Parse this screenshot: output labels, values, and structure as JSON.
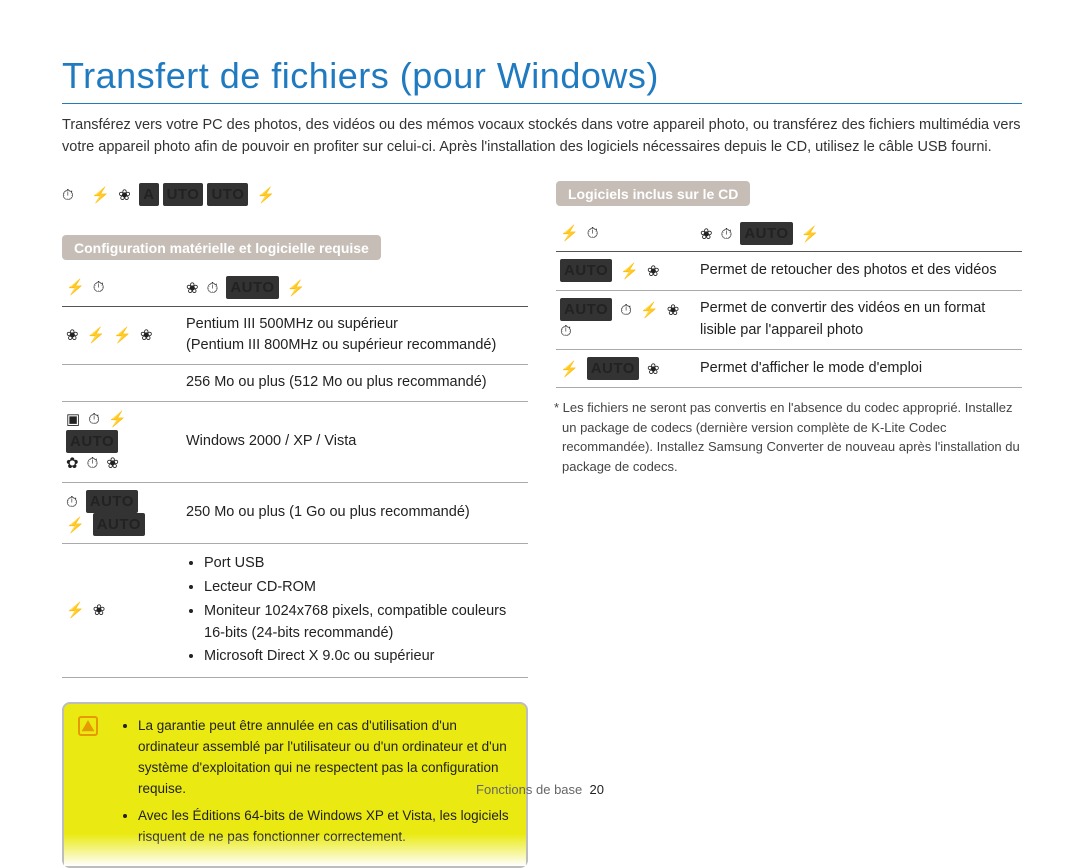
{
  "title": "Transfert de fichiers (pour Windows)",
  "intro": "Transférez vers votre PC des photos, des vidéos ou des mémos vocaux stockés dans votre appareil photo, ou transférez des fichiers multimédia vers votre appareil photo afin de pouvoir en profiter sur celui-ci. Après l'installation des logiciels nécessaires depuis le CD, utilisez le câble USB fourni.",
  "left": {
    "header": "Configuration matérielle et logicielle requise",
    "rows": [
      {
        "value_line1": "Pentium III 500MHz ou supérieur",
        "value_line2": "(Pentium III 800MHz ou supérieur recommandé)"
      },
      {
        "value": "256 Mo ou plus (512 Mo ou plus recommandé)"
      },
      {
        "value": "Windows 2000 / XP / Vista"
      },
      {
        "value": "250 Mo ou plus (1 Go ou plus recommandé)"
      },
      {
        "bullets": [
          "Port USB",
          "Lecteur CD-ROM",
          "Moniteur 1024x768 pixels, compatible couleurs 16-bits (24-bits recommandé)",
          "Microsoft Direct X 9.0c ou supérieur"
        ]
      }
    ]
  },
  "right": {
    "header": "Logiciels inclus sur le CD",
    "rows": [
      {
        "value": "Permet de retoucher des photos et des vidéos"
      },
      {
        "value": "Permet de convertir des vidéos en un format lisible par l'appareil photo"
      },
      {
        "value": "Permet d'afficher le mode d'emploi"
      }
    ],
    "note": "* Les fichiers ne seront pas convertis en l'absence du codec approprié. Installez un package de codecs (dernière version complète de K-Lite Codec recommandée). Installez Samsung Converter de nouveau après l'installation du package de codecs."
  },
  "warning": {
    "items": [
      "La garantie peut être annulée en cas d'utilisation d'un ordinateur assemblé par l'utilisateur ou d'un ordinateur et d'un système d'exploitation qui ne respectent pas la configuration requise.",
      "Avec les Éditions 64-bits de Windows XP et Vista, les logiciels risquent de ne pas fonctionner correctement."
    ]
  },
  "footer": {
    "section": "Fonctions de base",
    "page": "20"
  }
}
